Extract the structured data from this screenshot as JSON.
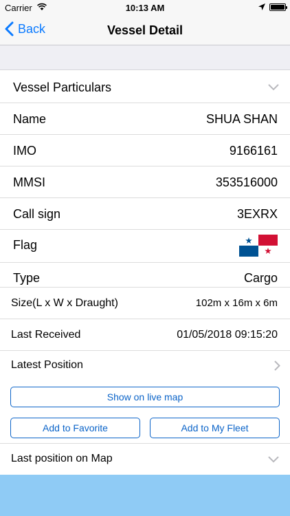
{
  "status": {
    "carrier": "Carrier",
    "time": "10:13 AM"
  },
  "nav": {
    "back_label": "Back",
    "title": "Vessel Detail"
  },
  "section": {
    "title": "Vessel Particulars"
  },
  "fields": {
    "name": {
      "label": "Name",
      "value": "SHUA SHAN"
    },
    "imo": {
      "label": "IMO",
      "value": "9166161"
    },
    "mmsi": {
      "label": "MMSI",
      "value": "353516000"
    },
    "callsign": {
      "label": "Call sign",
      "value": "3EXRX"
    },
    "flag": {
      "label": "Flag",
      "country": "Panama"
    },
    "type": {
      "label": "Type",
      "value": "Cargo"
    },
    "size": {
      "label": "Size(L x W x Draught)",
      "value": "102m x 16m x 6m"
    },
    "last_received": {
      "label": "Last Received",
      "value": "01/05/2018 09:15:20"
    },
    "latest_position": {
      "label": "Latest Position"
    }
  },
  "buttons": {
    "show_map": "Show on live map",
    "favorite": "Add to Favorite",
    "fleet": "Add to My Fleet"
  },
  "map_section": {
    "label": "Last position on Map"
  },
  "colors": {
    "accent": "#0a7aff",
    "button": "#0a63c8",
    "map_band": "#8fcbf5"
  }
}
